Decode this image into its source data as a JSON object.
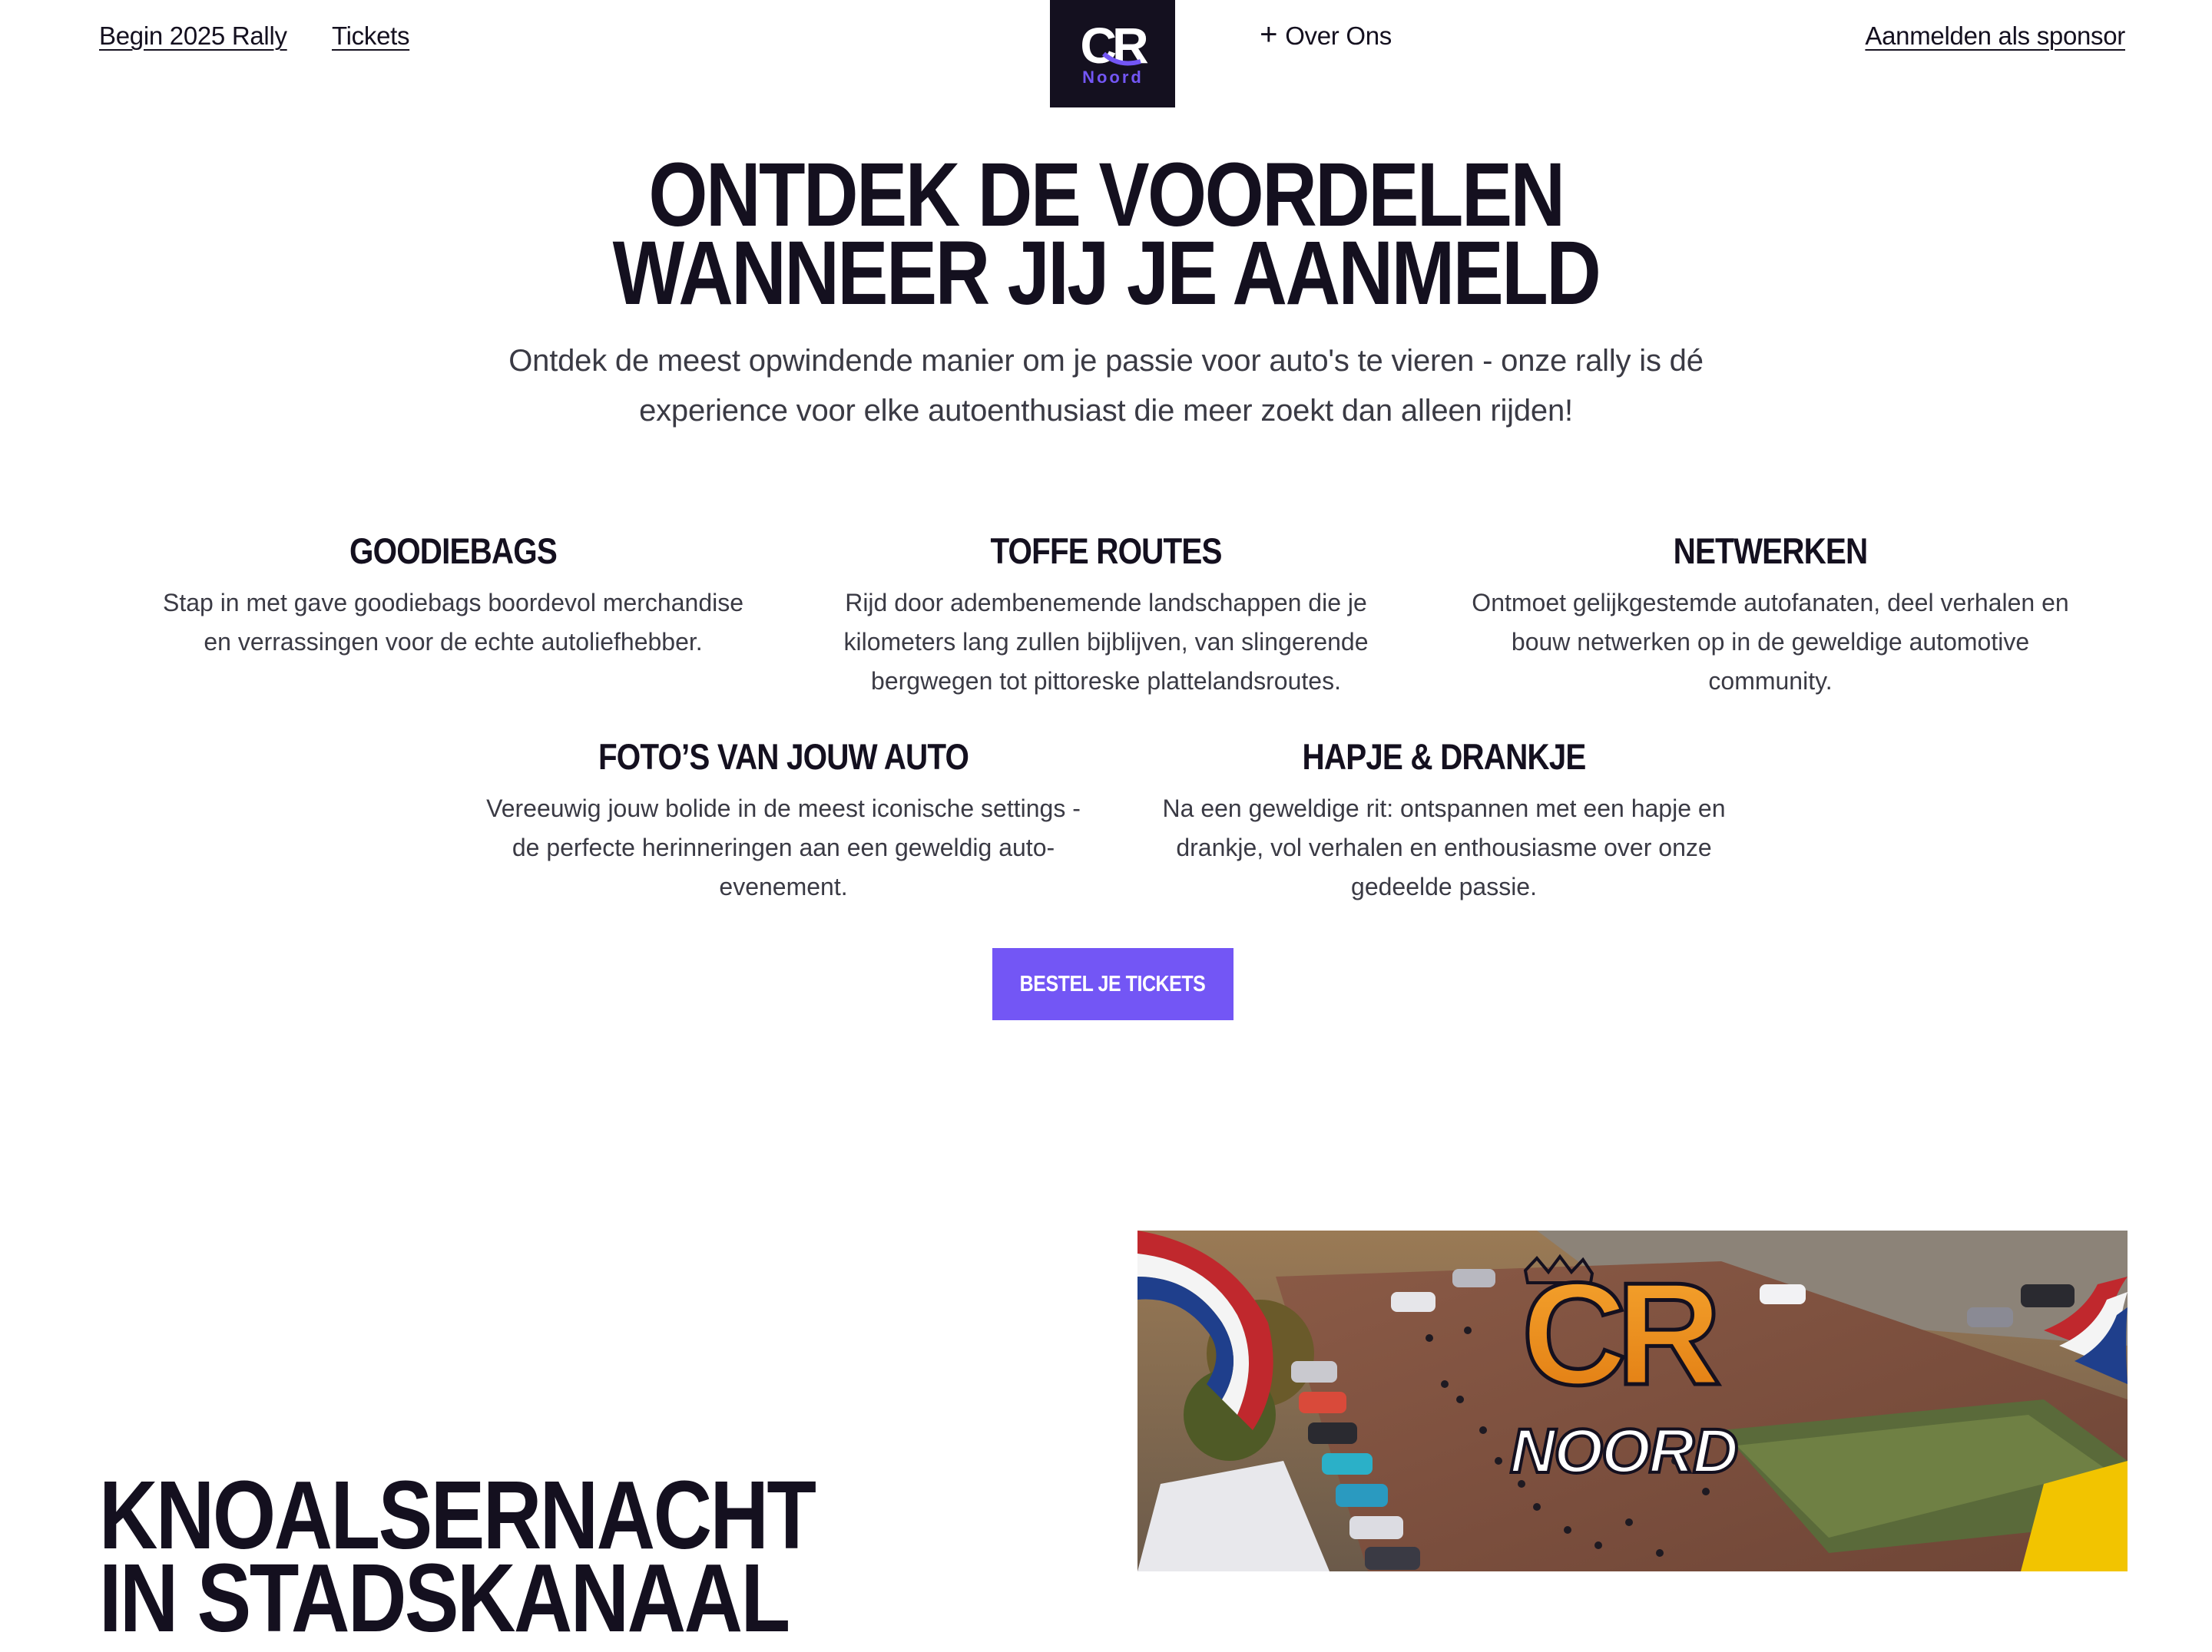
{
  "header": {
    "nav_begin": "Begin 2025 Rally",
    "nav_tickets": "Tickets",
    "nav_over": "Over Ons",
    "nav_sponsor": "Aanmelden als sponsor",
    "logo_text": "CR",
    "logo_sub": "Noord"
  },
  "hero": {
    "title_line1": "ONTDEK DE VOORDELEN",
    "title_line2": "WANNEER JIJ JE AANMELD",
    "subtitle": "Ontdek de meest opwindende manier om je passie voor auto's te vieren - onze rally is dé experience voor elke autoenthusiast die meer zoekt dan alleen rijden!"
  },
  "features": [
    {
      "title": "GOODIEBAGS",
      "text": "Stap in met gave goodiebags boordevol merchandise en verrassingen voor de echte autoliefhebber."
    },
    {
      "title": "TOFFE ROUTES",
      "text": "Rijd door adembenemende landschappen die je kilometers lang zullen bijblijven, van slingerende bergwegen tot pittoreske plattelandsroutes."
    },
    {
      "title": "NETWERKEN",
      "text": "Ontmoet gelijkgestemde autofanaten, deel verhalen en bouw netwerken op in de geweldige automotive community."
    },
    {
      "title": "FOTO’S VAN JOUW AUTO",
      "text": "Vereeuwig jouw bolide in de meest iconische settings - de perfecte herinneringen aan een geweldig auto-evenement."
    },
    {
      "title": "HAPJE & DRANKJE",
      "text": "Na een geweldige rit: ontspannen met een hapje en drankje, vol verhalen en enthousiasme over onze gedeelde passie."
    }
  ],
  "cta": {
    "label": "BESTEL JE TICKETS"
  },
  "event": {
    "title_line1": "KNOALSERNACHT",
    "title_line2": "IN STADSKANAAL",
    "image_logo": "CR",
    "image_logo_sub": "NOORD"
  },
  "colors": {
    "primary_dark": "#14101f",
    "accent": "#7356f5",
    "body_text": "#3a3a44",
    "logo_orange": "#f0901e"
  }
}
